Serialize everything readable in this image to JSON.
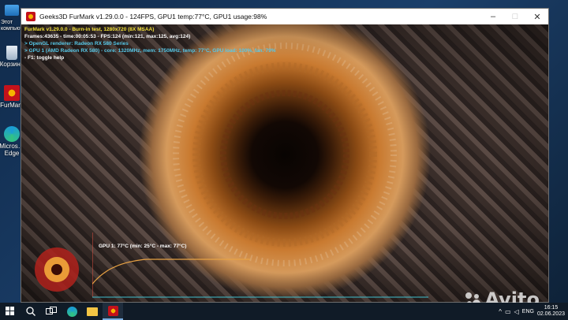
{
  "desktop": {
    "icons": [
      {
        "label_line1": "Этот",
        "label_line2": "компьют…",
        "icon": "computer-icon"
      },
      {
        "label_line1": "Корзина",
        "icon": "recycle-bin-icon"
      },
      {
        "label_line1": "FurMark",
        "icon": "furmark-icon"
      },
      {
        "label_line1": "Micros…",
        "label_line2": "Edge",
        "icon": "edge-icon"
      }
    ]
  },
  "window": {
    "title": "Geeks3D FurMark v1.29.0.0 - 124FPS, GPU1 temp:77°C, GPU1 usage:98%",
    "buttons": {
      "minimize": "–",
      "maximize": "□",
      "close": "✕"
    }
  },
  "osd": {
    "line1": "FurMark v1.29.0.0 - Burn-in test, 1280x720 (8X MSAA)",
    "line2": "Frames:43635 - time:00:05:53 - FPS:124 (min:121, max:125, avg:124)",
    "line3": "> OpenGL renderer: Radeon RX 580 Series",
    "line4": "> GPU 1 (AMD Radeon RX 580) - core: 1320MHz, mem: 1750MHz, temp: 77°C, GPU load: 100%, fan: 79%",
    "line5": "- F1: toggle help"
  },
  "graph": {
    "label": "GPU 1: 77°C (min: 25°C - max: 77°C)",
    "min_temp": 25,
    "max_temp": 77,
    "current_temp": 77,
    "line_color": "#e8a244"
  },
  "taskbar": {
    "lang": "ENG",
    "time": "16:15",
    "date": "02.06.2023",
    "items": [
      "start-icon",
      "search-icon",
      "task-view-icon",
      "edge-icon",
      "explorer-icon",
      "furmark-icon"
    ]
  },
  "watermark": {
    "word": "Avito",
    "logo_text": "FurMark"
  },
  "colors": {
    "osd_yellow": "#f4e23a",
    "osd_cyan": "#56c8e8",
    "titlebar": "#ffffff",
    "taskbar": "#101b27"
  }
}
